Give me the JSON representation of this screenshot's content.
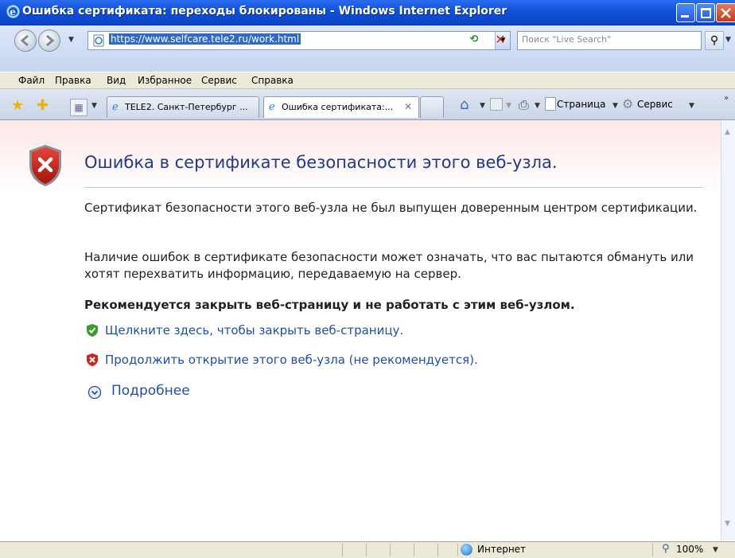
{
  "window": {
    "title": "Ошибка сертификата: переходы блокированы - Windows Internet Explorer"
  },
  "address": {
    "url": "https://www.selfcare.tele2.ru/work.html",
    "search_placeholder": "Поиск \"Live Search\""
  },
  "menu": [
    "Файл",
    "Правка",
    "Вид",
    "Избранное",
    "Сервис",
    "Справка"
  ],
  "tabs": [
    {
      "label": "TELE2. Санкт-Петербург ..."
    },
    {
      "label": "Ошибка сертификата:..."
    }
  ],
  "toolbar": {
    "page_label": "Страница",
    "tools_label": "Сервис"
  },
  "content": {
    "title": "Ошибка в сертификате безопасности этого веб-узла.",
    "para1": "Сертификат безопасности этого веб-узла не был выпущен доверенным центром сертификации.",
    "para2": "Наличие ошибок в сертификате безопасности может означать, что вас пытаются обмануть или хотят перехватить информацию, передаваемую на сервер.",
    "recommend": "Рекомендуется закрыть веб-страницу и не работать с этим веб-узлом.",
    "close_link": "Щелкните здесь, чтобы закрыть веб-страницу.",
    "continue_link": "Продолжить открытие этого веб-узла (не рекомендуется).",
    "more_link": "Подробнее"
  },
  "status": {
    "zone": "Интернет",
    "zoom": "100%"
  },
  "colors": {
    "link": "#1f4fa8",
    "title": "#1f3a8c",
    "titlebar": "#1050d8"
  }
}
